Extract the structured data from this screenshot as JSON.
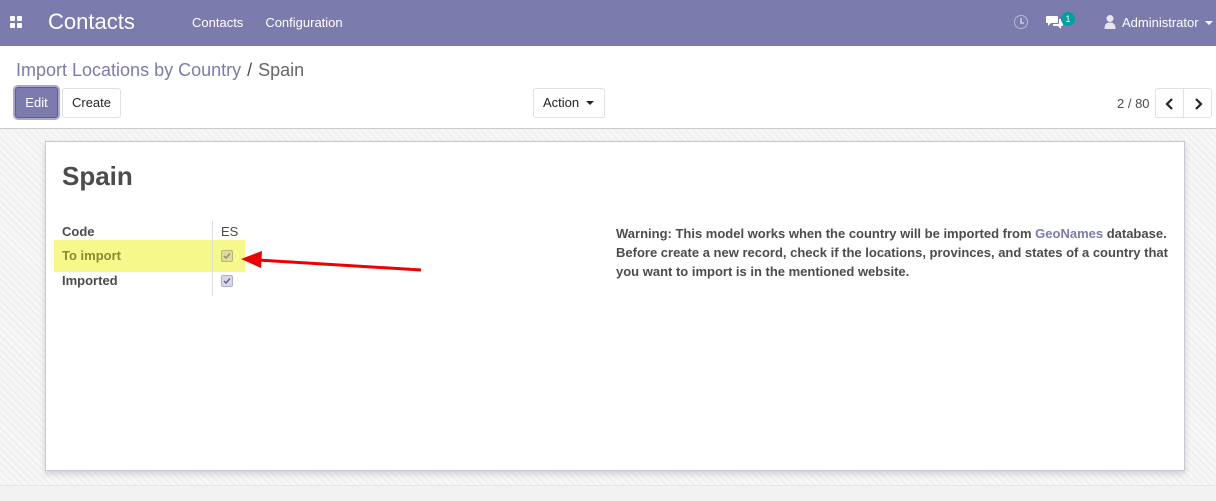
{
  "navbar": {
    "app_title": "Contacts",
    "menu": [
      "Contacts",
      "Configuration"
    ],
    "chat_badge": "1",
    "user_name": "Administrator",
    "icons": [
      "apps-grid-icon",
      "clock-icon",
      "chat-icon",
      "user-icon"
    ],
    "color": "#7c7bad"
  },
  "breadcrumb": {
    "parent": "Import Locations by Country",
    "separator": "/",
    "current": "Spain"
  },
  "toolbar": {
    "edit_label": "Edit",
    "create_label": "Create",
    "action_label": "Action"
  },
  "pager": {
    "value": "2 / 80"
  },
  "record": {
    "title": "Spain",
    "fields": {
      "code_label": "Code",
      "code_value": "ES",
      "to_import_label": "To import",
      "to_import_checked": true,
      "imported_label": "Imported",
      "imported_checked": true
    },
    "warning": {
      "prefix": "Warning: This model works when the country will be imported from ",
      "link": "GeoNames",
      "suffix": " database. Before create a new record, check if the locations, provinces, and states of a country that you want to import is in the mentioned website."
    }
  },
  "annotation": {
    "highlight_color": "#f6f88a",
    "arrow_color": "#ee0000"
  }
}
